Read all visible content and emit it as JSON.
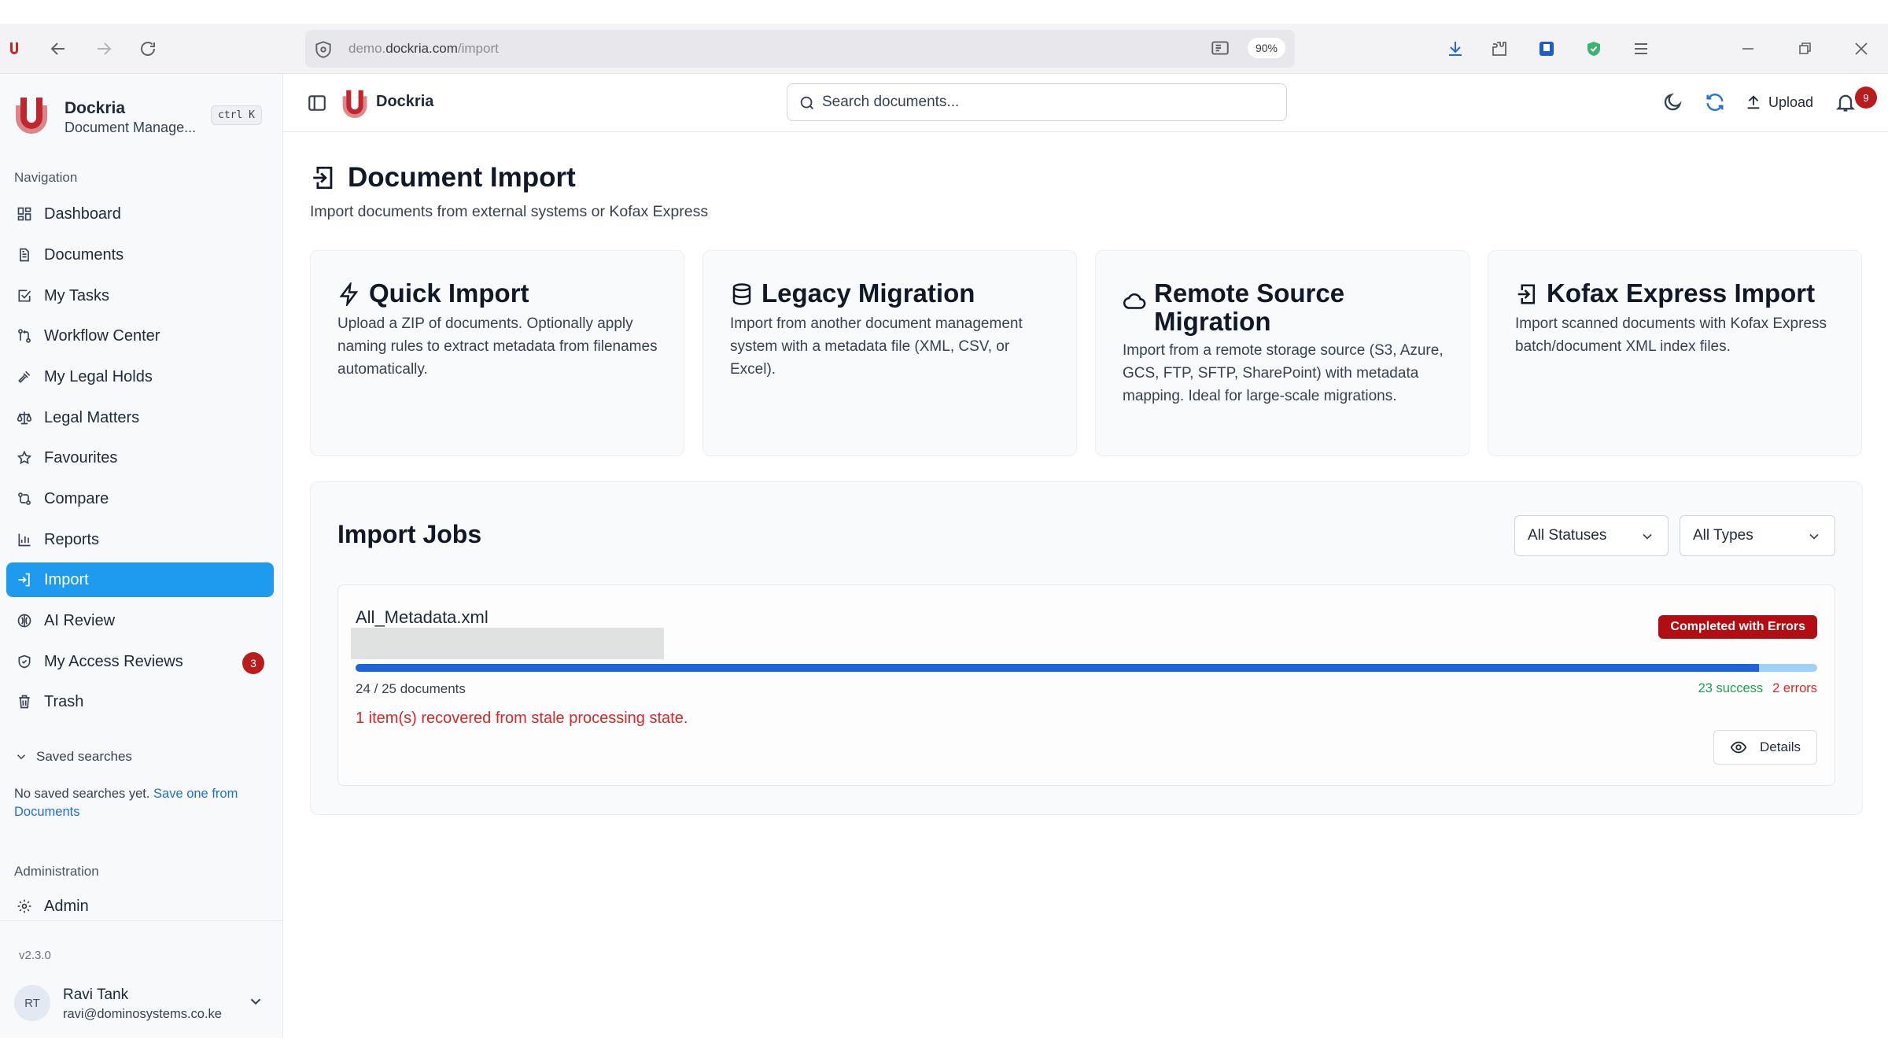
{
  "browser": {
    "url_host": "demo.",
    "url_domain": "dockria.com",
    "url_path": "/import",
    "zoom": "90%"
  },
  "sidebar": {
    "brand_name": "Dockria",
    "brand_sub": "Document Manage...",
    "shortcut": "ctrl K",
    "nav_section": "Navigation",
    "items": [
      {
        "label": "Dashboard",
        "icon": "dashboard-icon"
      },
      {
        "label": "Documents",
        "icon": "document-icon"
      },
      {
        "label": "My Tasks",
        "icon": "checkbox-icon"
      },
      {
        "label": "Workflow Center",
        "icon": "workflow-icon"
      },
      {
        "label": "My Legal Holds",
        "icon": "gavel-icon"
      },
      {
        "label": "Legal Matters",
        "icon": "scale-icon"
      },
      {
        "label": "Favourites",
        "icon": "star-icon"
      },
      {
        "label": "Compare",
        "icon": "compare-icon"
      },
      {
        "label": "Reports",
        "icon": "chart-icon"
      },
      {
        "label": "Import",
        "icon": "import-icon"
      },
      {
        "label": "AI Review",
        "icon": "brain-icon"
      },
      {
        "label": "My Access Reviews",
        "icon": "shield-check-icon",
        "badge": "3"
      },
      {
        "label": "Trash",
        "icon": "trash-icon"
      }
    ],
    "saved_searches_label": "Saved searches",
    "saved_empty_text": "No saved searches yet. ",
    "saved_empty_link": "Save one from Documents",
    "admin_section": "Administration",
    "admin_item": "Admin",
    "version": "v2.3.0",
    "user": {
      "initials": "RT",
      "name": "Ravi Tank",
      "email": "ravi@dominosystems.co.ke"
    }
  },
  "header": {
    "brand": "Dockria",
    "search_placeholder": "Search documents...",
    "upload_label": "Upload",
    "notification_count": "9"
  },
  "main": {
    "title": "Document Import",
    "subtitle": "Import documents from external systems or Kofax Express",
    "cards": [
      {
        "title": "Quick Import",
        "icon": "lightning-icon",
        "desc": "Upload a ZIP of documents. Optionally apply naming rules to extract metadata from filenames automatically."
      },
      {
        "title": "Legacy Migration",
        "icon": "database-icon",
        "desc": "Import from another document management system with a metadata file (XML, CSV, or Excel)."
      },
      {
        "title": "Remote Source Migration",
        "icon": "cloud-icon",
        "desc": "Import from a remote storage source (S3, Azure, GCS, FTP, SFTP, SharePoint) with metadata mapping. Ideal for large-scale migrations."
      },
      {
        "title": "Kofax Express Import",
        "icon": "import-icon",
        "desc": "Import scanned documents with Kofax Express batch/document XML index files."
      }
    ],
    "jobs": {
      "title": "Import Jobs",
      "status_filter": "All Statuses",
      "type_filter": "All Types",
      "items": [
        {
          "name": "All_Metadata.xml",
          "status": "Completed with Errors",
          "processed": 24,
          "total": 25,
          "count_text": "24 / 25 documents",
          "success_text": "23 success",
          "error_text": "2 errors",
          "warning": "1 item(s) recovered from stale processing state.",
          "details_label": "Details"
        }
      ]
    }
  },
  "colors": {
    "accent": "#1e9bef",
    "danger": "#b30d14",
    "success": "#16a34a",
    "progress": "#1d64d8"
  }
}
